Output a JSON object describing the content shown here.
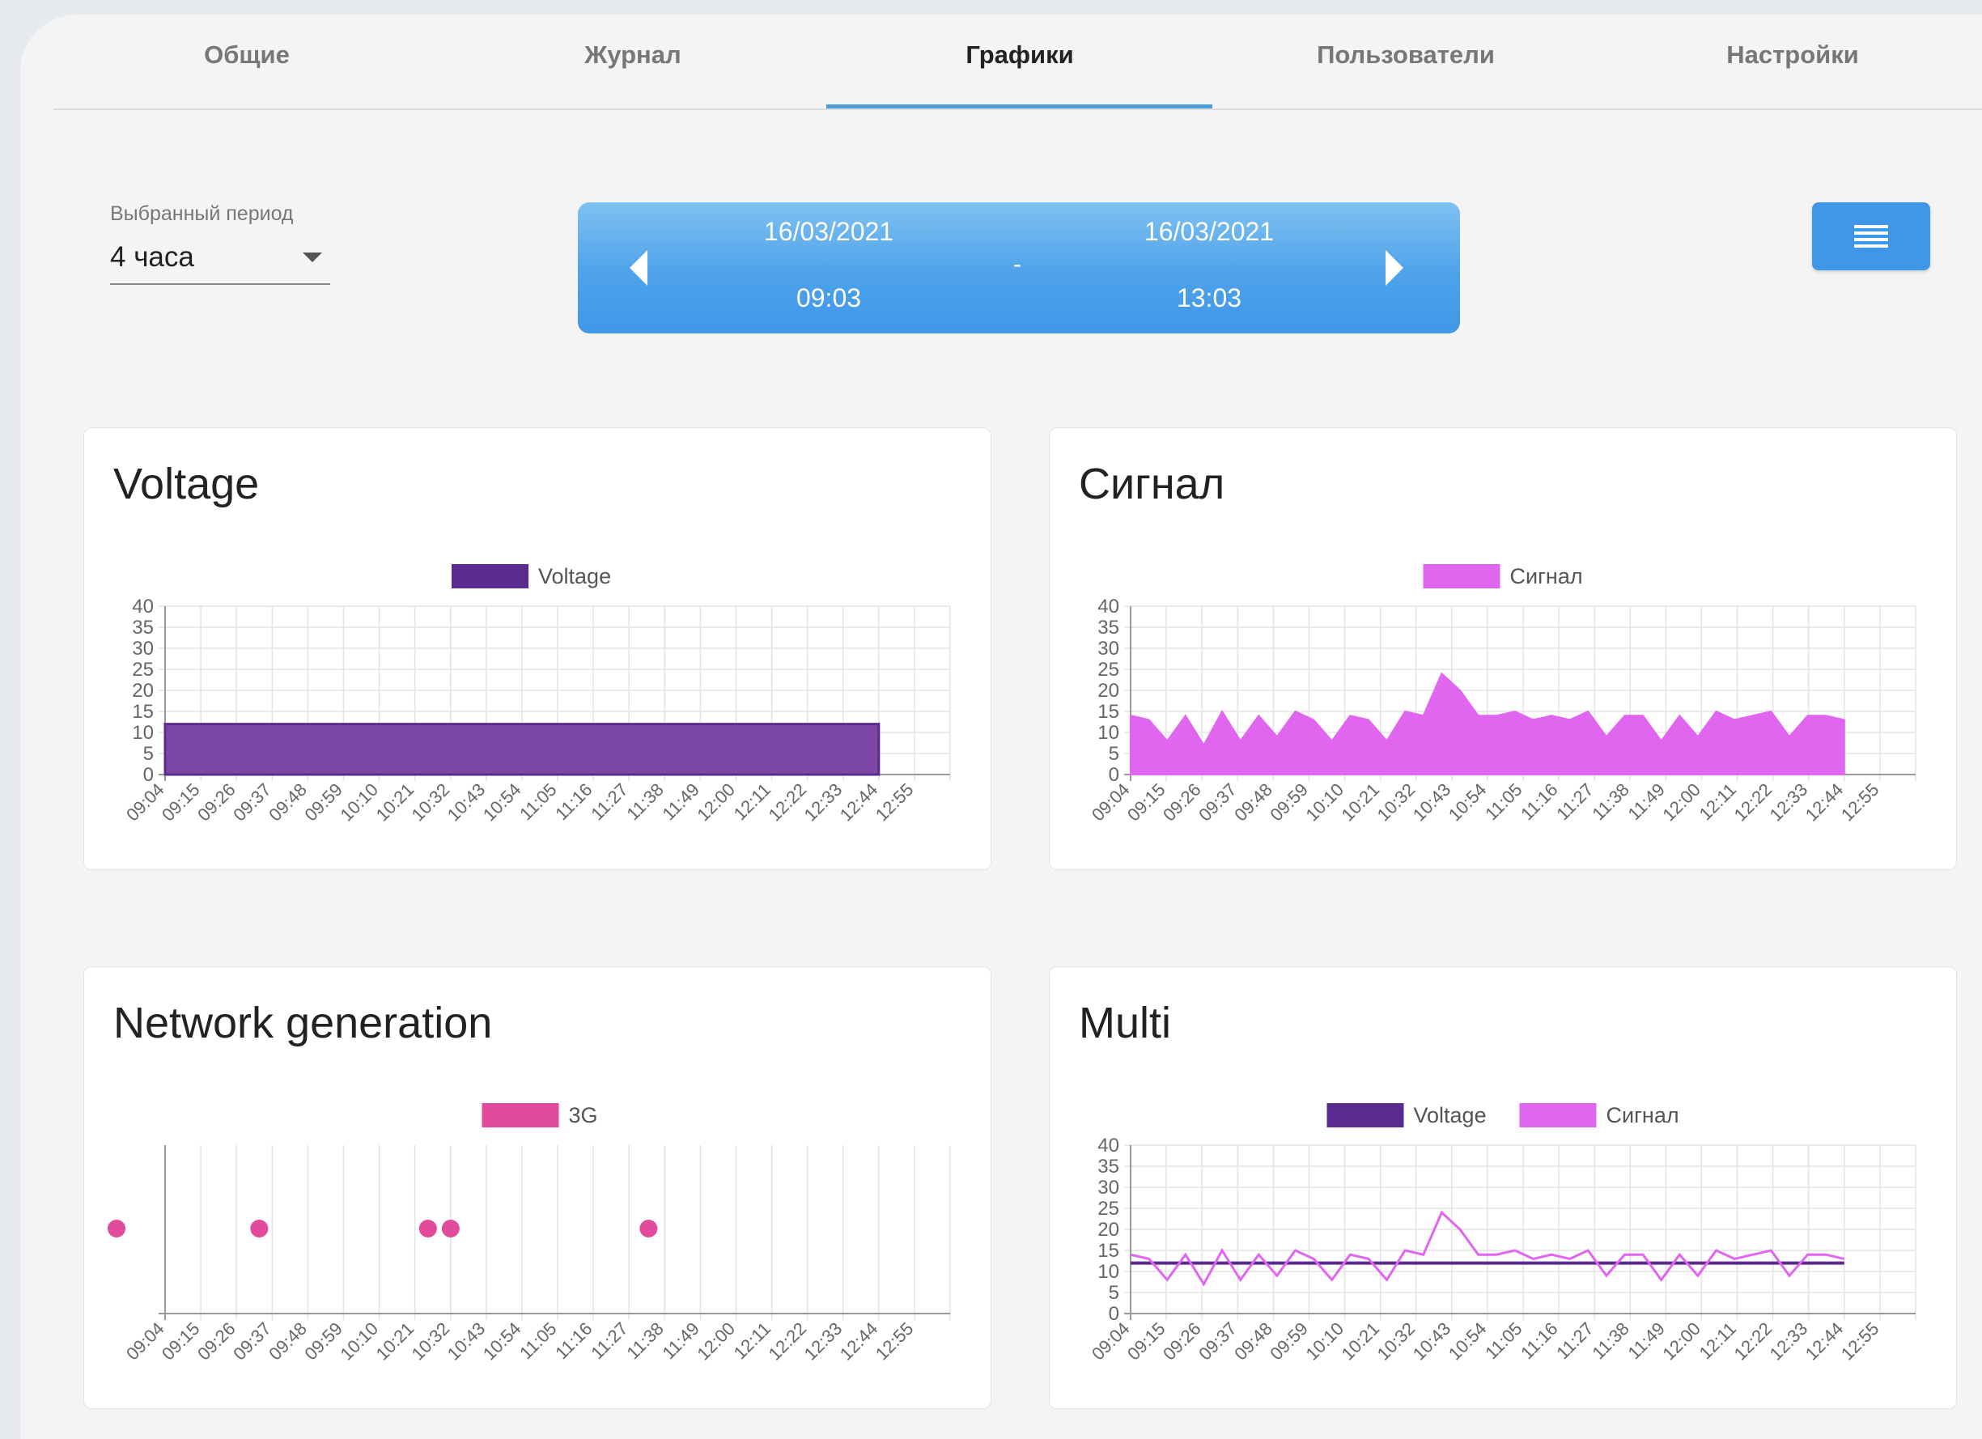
{
  "tabs": [
    "Общие",
    "Журнал",
    "Графики",
    "Пользователи",
    "Настройки"
  ],
  "active_tab": 2,
  "period": {
    "label": "Выбранный период",
    "value": "4 часа"
  },
  "range": {
    "start_date": "16/03/2021",
    "start_time": "09:03",
    "end_date": "16/03/2021",
    "end_time": "13:03",
    "separator": "-"
  },
  "colors": {
    "accent": "#3f97e8",
    "voltage": "#5b2a8e",
    "voltage_fill": "#7d47a7",
    "signal": "#e066f0",
    "g3": "#e24a9c"
  },
  "menu_icon": "hamburger-icon",
  "charts": {
    "voltage": {
      "title": "Voltage"
    },
    "signal": {
      "title": "Сигнал"
    },
    "network": {
      "title": "Network generation"
    },
    "multi": {
      "title": "Multi"
    }
  },
  "chart_data": [
    {
      "type": "area",
      "title": "Voltage",
      "categories": [
        "09:04",
        "09:15",
        "09:26",
        "09:37",
        "09:48",
        "09:59",
        "10:10",
        "10:21",
        "10:32",
        "10:43",
        "10:54",
        "11:05",
        "11:16",
        "11:27",
        "11:38",
        "11:49",
        "12:00",
        "12:11",
        "12:22",
        "12:33",
        "12:44",
        "12:55"
      ],
      "yticks": [
        0,
        5,
        10,
        15,
        20,
        25,
        30,
        35,
        40
      ],
      "ylim": [
        0,
        40
      ],
      "series": [
        {
          "name": "Voltage",
          "values": [
            12,
            12,
            12,
            12,
            12,
            12,
            12,
            12,
            12,
            12,
            12,
            12,
            12,
            12,
            12,
            12,
            12,
            12,
            12,
            12,
            12
          ]
        }
      ]
    },
    {
      "type": "area",
      "title": "Сигнал",
      "categories": [
        "09:04",
        "09:15",
        "09:26",
        "09:37",
        "09:48",
        "09:59",
        "10:10",
        "10:21",
        "10:32",
        "10:43",
        "10:54",
        "11:05",
        "11:16",
        "11:27",
        "11:38",
        "11:49",
        "12:00",
        "12:11",
        "12:22",
        "12:33",
        "12:44",
        "12:55"
      ],
      "yticks": [
        0,
        5,
        10,
        15,
        20,
        25,
        30,
        35,
        40
      ],
      "ylim": [
        0,
        40
      ],
      "series": [
        {
          "name": "Сигнал",
          "values": [
            14,
            13,
            8,
            14,
            7,
            15,
            8,
            14,
            9,
            15,
            13,
            8,
            14,
            13,
            8,
            15,
            14,
            24,
            20,
            14,
            14,
            15,
            13,
            14,
            13,
            15,
            9,
            14,
            14,
            8,
            14,
            9,
            15,
            13,
            14,
            15,
            9,
            14,
            14,
            13
          ]
        }
      ]
    },
    {
      "type": "scatter",
      "title": "Network generation",
      "categories": [
        "09:04",
        "09:15",
        "09:26",
        "09:37",
        "09:48",
        "09:59",
        "10:10",
        "10:21",
        "10:32",
        "10:43",
        "10:54",
        "11:05",
        "11:16",
        "11:27",
        "11:38",
        "11:49",
        "12:00",
        "12:11",
        "12:22",
        "12:33",
        "12:44",
        "12:55"
      ],
      "series": [
        {
          "name": "3G",
          "x": [
            "09:04",
            "09:48",
            "10:40",
            "10:47",
            "11:48"
          ]
        }
      ]
    },
    {
      "type": "line",
      "title": "Multi",
      "categories": [
        "09:04",
        "09:15",
        "09:26",
        "09:37",
        "09:48",
        "09:59",
        "10:10",
        "10:21",
        "10:32",
        "10:43",
        "10:54",
        "11:05",
        "11:16",
        "11:27",
        "11:38",
        "11:49",
        "12:00",
        "12:11",
        "12:22",
        "12:33",
        "12:44",
        "12:55"
      ],
      "yticks": [
        0,
        5,
        10,
        15,
        20,
        25,
        30,
        35,
        40
      ],
      "ylim": [
        0,
        40
      ],
      "series": [
        {
          "name": "Voltage",
          "values": [
            12,
            12,
            12,
            12,
            12,
            12,
            12,
            12,
            12,
            12,
            12,
            12,
            12,
            12,
            12,
            12,
            12,
            12,
            12,
            12,
            12
          ]
        },
        {
          "name": "Сигнал",
          "values": [
            14,
            13,
            8,
            14,
            7,
            15,
            8,
            14,
            9,
            15,
            13,
            8,
            14,
            13,
            8,
            15,
            14,
            24,
            20,
            14,
            14,
            15,
            13,
            14,
            13,
            15,
            9,
            14,
            14,
            8,
            14,
            9,
            15,
            13,
            14,
            15,
            9,
            14,
            14,
            13
          ]
        }
      ]
    }
  ]
}
